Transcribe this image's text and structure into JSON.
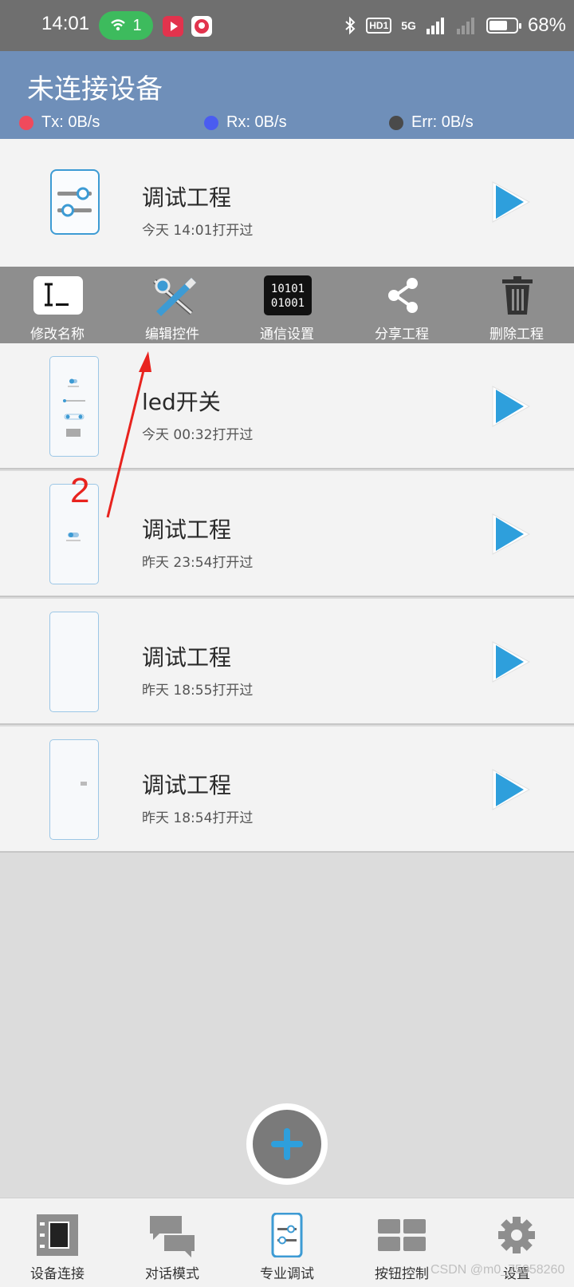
{
  "status_bar": {
    "time": "14:01",
    "hotspot_count": "1",
    "hd_label": "HD1",
    "network_label": "5G",
    "battery_percent": "68%",
    "battery_level": 0.68
  },
  "header": {
    "title": "未连接设备",
    "tx": "Tx: 0B/s",
    "rx": "Rx: 0B/s",
    "err": "Err: 0B/s",
    "tx_color": "#f04a5c",
    "rx_color": "#4a5cf0",
    "err_color": "#4a4a4a"
  },
  "projects": [
    {
      "name": "调试工程",
      "opened": "今天 14:01打开过"
    },
    {
      "name": "led开关",
      "opened": "今天 00:32打开过"
    },
    {
      "name": "调试工程",
      "opened": "昨天 23:54打开过"
    },
    {
      "name": "调试工程",
      "opened": "昨天 18:55打开过"
    },
    {
      "name": "调试工程",
      "opened": "昨天 18:54打开过"
    }
  ],
  "actions": {
    "rename": "修改名称",
    "edit_controls": "编辑控件",
    "comm_settings": "通信设置",
    "comm_icon_line1": "10101",
    "comm_icon_line2": "01001",
    "share": "分享工程",
    "delete": "删除工程"
  },
  "annotation": {
    "number": "2"
  },
  "nav": {
    "device_connect": "设备连接",
    "chat_mode": "对话模式",
    "pro_debug": "专业调试",
    "button_control": "按钮控制",
    "settings": "设置"
  },
  "watermark": "CSDN @m0_75058260",
  "colors": {
    "accent": "#3d9bd4",
    "header_bg": "#6f8fb9",
    "annotation": "#e8231e"
  }
}
